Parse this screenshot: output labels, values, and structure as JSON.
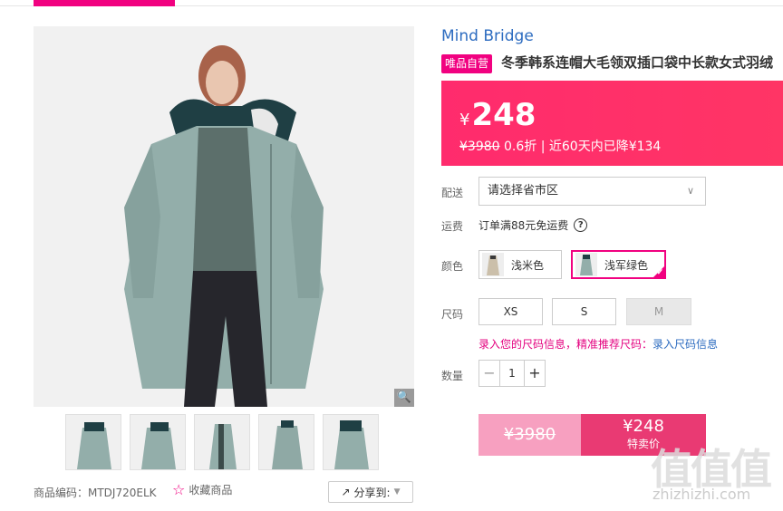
{
  "brand": "Mind Bridge",
  "badge": "唯品自营",
  "title": "冬季韩系连帽大毛领双插口袋中长款女式羽绒",
  "price": {
    "currency": "¥",
    "current": "248",
    "original": "¥3980",
    "discount": "0.6折",
    "note": "| 近60天内已降¥134"
  },
  "delivery": {
    "label": "配送",
    "placeholder": "请选择省市区"
  },
  "shipping": {
    "label": "运费",
    "text": "订单满88元免运费",
    "help": "?"
  },
  "color": {
    "label": "颜色",
    "options": [
      {
        "name": "浅米色",
        "selected": false
      },
      {
        "name": "浅军绿色",
        "selected": true
      }
    ]
  },
  "size": {
    "label": "尺码",
    "options": [
      {
        "name": "XS",
        "available": true
      },
      {
        "name": "S",
        "available": true
      },
      {
        "name": "M",
        "available": false
      }
    ],
    "tip": "录入您的尺码信息，精准推荐尺码：",
    "tip_link": "录入尺码信息"
  },
  "quantity": {
    "label": "数量",
    "value": "1",
    "minus": "−",
    "plus": "+"
  },
  "buy": {
    "original": "¥3980",
    "price": "¥248",
    "label": "特卖价 ",
    "check": "✔"
  },
  "product_code": "商品编码：MTDJ720ELK",
  "favorite": "收藏商品",
  "share": "分享到:",
  "watermark": {
    "big": "值值值",
    "small": "zhizhizhi.com"
  },
  "colors": {
    "accent": "#f10180",
    "price_bg": "#ff2b6d",
    "link": "#2d6cc0"
  }
}
